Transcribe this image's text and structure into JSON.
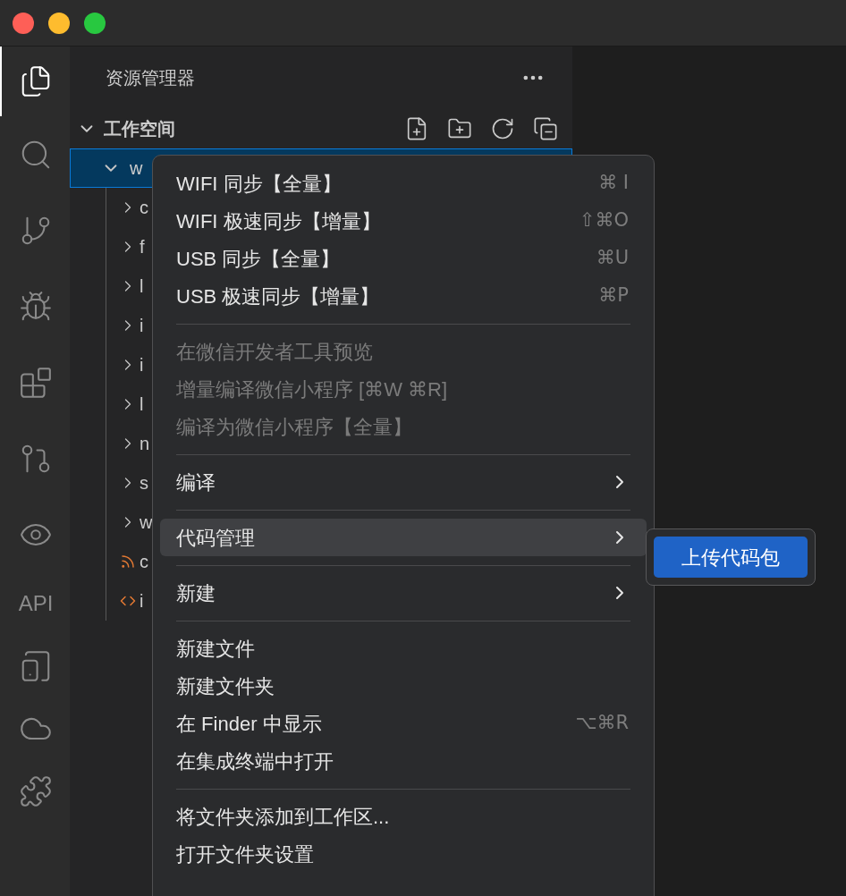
{
  "activity_bar": {
    "items": [
      {
        "kind": "files",
        "selected": true
      },
      {
        "kind": "search",
        "selected": false
      },
      {
        "kind": "branch",
        "selected": false
      },
      {
        "kind": "debug",
        "selected": false
      },
      {
        "kind": "extensions",
        "selected": false
      },
      {
        "kind": "git-graph",
        "selected": false
      },
      {
        "kind": "eye",
        "selected": false
      },
      {
        "kind": "text",
        "label": "API",
        "selected": false
      },
      {
        "kind": "device",
        "selected": false
      },
      {
        "kind": "cloud",
        "selected": false
      },
      {
        "kind": "puzzle",
        "selected": false
      }
    ]
  },
  "sidebar": {
    "title": "资源管理器",
    "workspace": {
      "label": "工作空间",
      "expanded": true
    },
    "tree": [
      {
        "label": "w",
        "kind": "folder",
        "expanded": true,
        "selected": true,
        "children": [
          {
            "label": "c",
            "kind": "folder",
            "expanded": false,
            "selected": false
          },
          {
            "label": "f",
            "kind": "folder",
            "expanded": false,
            "selected": false
          },
          {
            "label": "l",
            "kind": "folder",
            "expanded": false,
            "selected": false
          },
          {
            "label": "i",
            "kind": "folder",
            "expanded": false,
            "selected": false
          },
          {
            "label": "i",
            "kind": "folder",
            "expanded": false,
            "selected": false
          },
          {
            "label": "l",
            "kind": "folder",
            "expanded": false,
            "selected": false
          },
          {
            "label": "n",
            "kind": "folder",
            "expanded": false,
            "selected": false
          },
          {
            "label": "s",
            "kind": "folder",
            "expanded": false,
            "selected": false
          },
          {
            "label": "w",
            "kind": "folder",
            "expanded": false,
            "selected": false
          },
          {
            "label": "c",
            "kind": "feed",
            "selected": false
          },
          {
            "label": "i",
            "kind": "markup",
            "selected": false
          }
        ]
      }
    ]
  },
  "context_menu": {
    "groups": [
      [
        {
          "label": "WIFI 同步【全量】",
          "shortcut": "⌘ I",
          "disabled": false,
          "selected": false
        },
        {
          "label": "WIFI 极速同步【增量】",
          "shortcut": "⇧⌘O",
          "disabled": false,
          "selected": false
        },
        {
          "label": "USB 同步【全量】",
          "shortcut": "⌘U",
          "disabled": false,
          "selected": false
        },
        {
          "label": "USB 极速同步【增量】",
          "shortcut": "⌘P",
          "disabled": false,
          "selected": false
        }
      ],
      [
        {
          "label": "在微信开发者工具预览",
          "disabled": true,
          "selected": false
        },
        {
          "label": "增量编译微信小程序 [⌘W ⌘R]",
          "disabled": true,
          "selected": false
        },
        {
          "label": "编译为微信小程序【全量】",
          "disabled": true,
          "selected": false
        }
      ],
      [
        {
          "label": "编译",
          "submenu": true,
          "disabled": false,
          "selected": false
        }
      ],
      [
        {
          "label": "代码管理",
          "submenu": true,
          "disabled": false,
          "selected": true
        }
      ],
      [
        {
          "label": "新建",
          "submenu": true,
          "disabled": false,
          "selected": false
        }
      ],
      [
        {
          "label": "新建文件",
          "disabled": false,
          "selected": false
        },
        {
          "label": "新建文件夹",
          "disabled": false,
          "selected": false
        },
        {
          "label": "在 Finder 中显示",
          "shortcut": "⌥⌘R",
          "disabled": false,
          "selected": false
        },
        {
          "label": "在集成终端中打开",
          "disabled": false,
          "selected": false
        }
      ],
      [
        {
          "label": "将文件夹添加到工作区...",
          "disabled": false,
          "selected": false
        },
        {
          "label": "打开文件夹设置",
          "disabled": false,
          "selected": false
        }
      ]
    ],
    "submenu": {
      "items": [
        {
          "label": "上传代码包",
          "selected": true
        }
      ]
    }
  }
}
